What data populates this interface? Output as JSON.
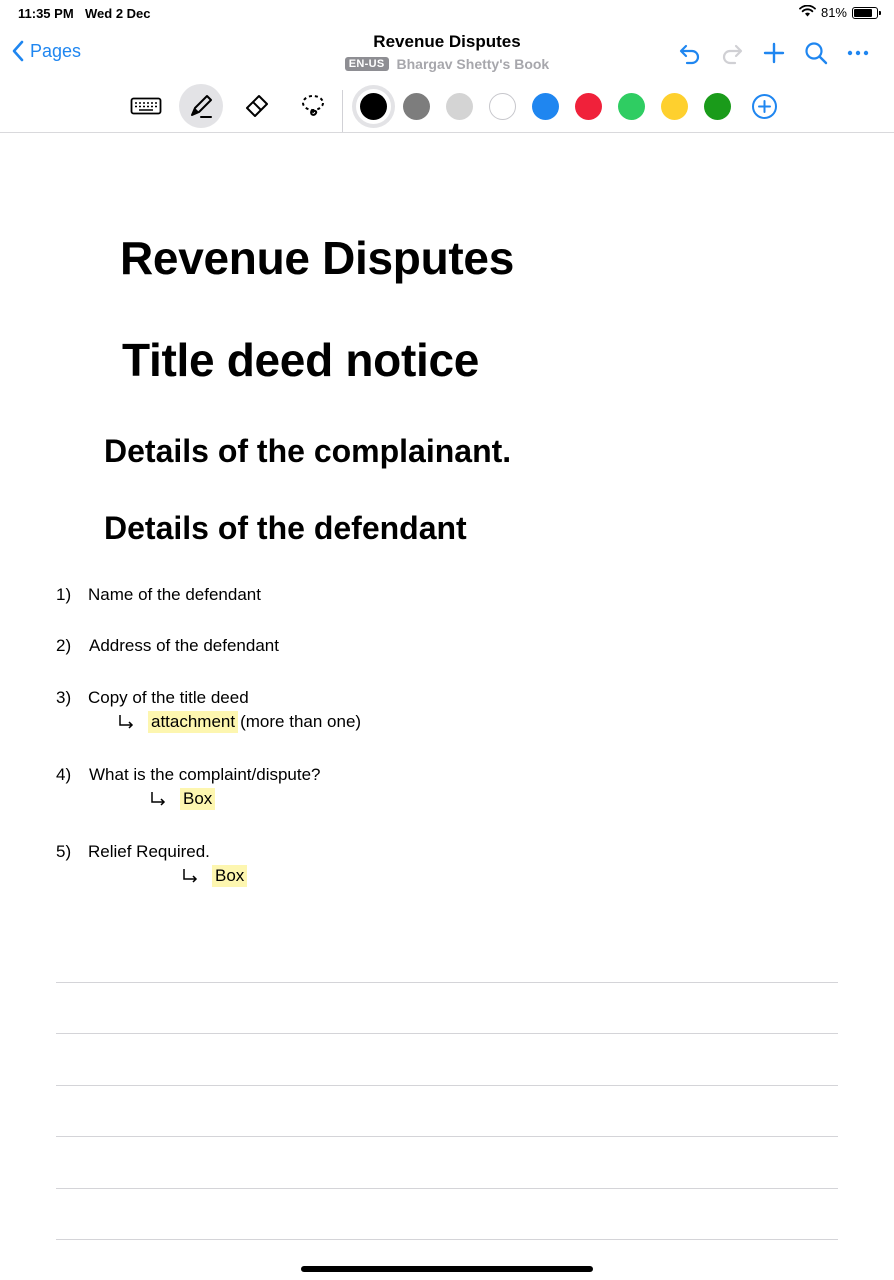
{
  "status": {
    "time": "11:35 PM",
    "date": "Wed 2 Dec",
    "battery": "81%",
    "battery_level": 0.81
  },
  "nav": {
    "back_label": "Pages",
    "title": "Revenue Disputes",
    "lang": "EN-US",
    "book": "Bhargav Shetty's Book",
    "actions": [
      "undo-icon",
      "redo-icon",
      "add-icon",
      "search-icon",
      "more-icon"
    ]
  },
  "toolbar": {
    "tools": [
      "keyboard-icon",
      "pen-icon",
      "eraser-icon",
      "lasso-icon"
    ],
    "active_tool": "pen-icon",
    "colors": [
      "#000000",
      "#7d7d7d",
      "#d4d4d4",
      "#ffffff",
      "#1f86f0",
      "#f0213a",
      "#2fcd62",
      "#fed02e",
      "#1a9b1a"
    ],
    "selected_color": "#000000",
    "accent": "#1f86f0"
  },
  "note": {
    "heading1": "Revenue Disputes",
    "heading2": "Title deed notice",
    "heading3": "Details of the complainant.",
    "heading4": "Details of the defendant",
    "items": [
      {
        "num": "1)",
        "text": "Name of the defendant"
      },
      {
        "num": "2)",
        "text": "Address of the defendant"
      },
      {
        "num": "3)",
        "text": "Copy of the title deed",
        "sub_highlight": "attachment",
        "sub_note": "(more than one)"
      },
      {
        "num": "4)",
        "text": "What is the complaint/dispute?",
        "sub_highlight": "Box"
      },
      {
        "num": "5)",
        "text": "Relief Required.",
        "sub_highlight": "Box"
      }
    ],
    "highlight_color": "#fdf6b0"
  }
}
